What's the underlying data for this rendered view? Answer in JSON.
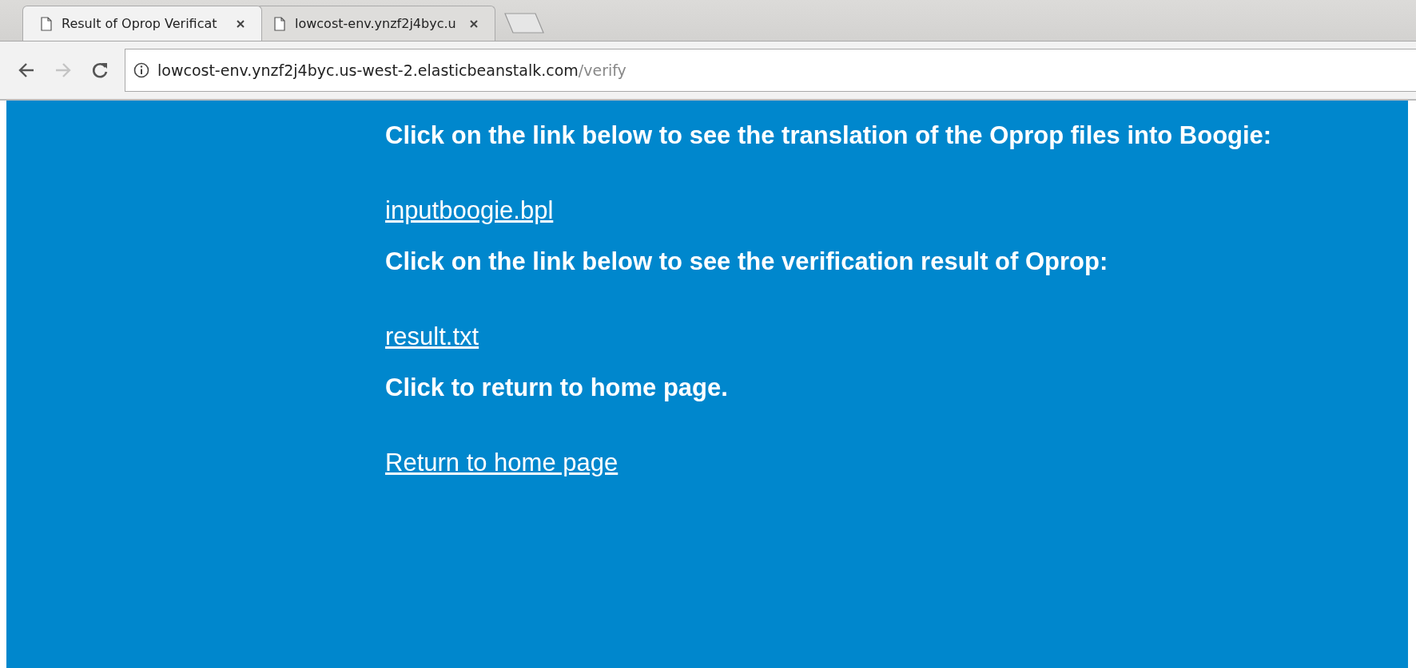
{
  "tabs": [
    {
      "title": "Result of Oprop Verificat",
      "selected": true
    },
    {
      "title": "lowcost-env.ynzf2j4byc.u",
      "selected": false
    }
  ],
  "address_bar": {
    "host": "lowcost-env.ynzf2j4byc.us-west-2.elasticbeanstalk.com",
    "path": "/verify"
  },
  "content": [
    {
      "kind": "heading",
      "text": "Click on the link below to see the translation of the Oprop files into Boogie:"
    },
    {
      "kind": "link",
      "text": "inputboogie.bpl"
    },
    {
      "kind": "heading",
      "text": "Click on the link below to see the verification result of Oprop:"
    },
    {
      "kind": "link",
      "text": "result.txt"
    },
    {
      "kind": "heading",
      "text": "Click to return to home page."
    },
    {
      "kind": "link",
      "text": "Return to home page"
    }
  ]
}
